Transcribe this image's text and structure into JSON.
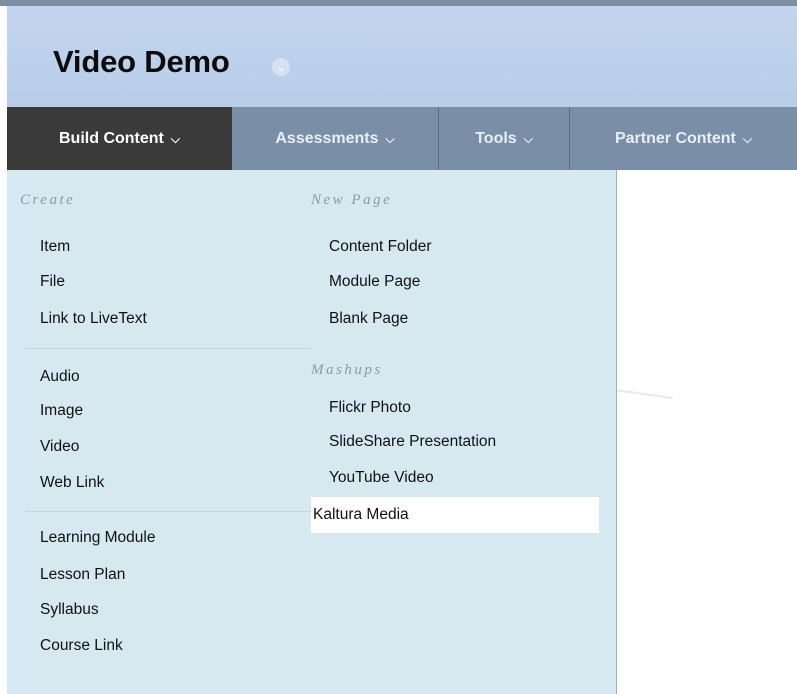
{
  "course": {
    "title": "Video Demo",
    "menu_icon": "chevron-down-icon"
  },
  "nav": {
    "tabs": [
      {
        "label": "Build Content",
        "icon": "chevron-down-icon",
        "active": true
      },
      {
        "label": "Assessments",
        "icon": "chevron-down-icon"
      },
      {
        "label": "Tools",
        "icon": "chevron-down-icon"
      },
      {
        "label": "Partner Content",
        "icon": "chevron-down-icon"
      }
    ]
  },
  "menu": {
    "create": {
      "heading": "Create",
      "group1": [
        "Item",
        "File",
        "Link to LiveText"
      ],
      "group2": [
        "Audio",
        "Image",
        "Video",
        "Web Link"
      ],
      "group3": [
        "Learning Module",
        "Lesson Plan",
        "Syllabus",
        "Course Link"
      ]
    },
    "new_page": {
      "heading": "New Page",
      "items": [
        "Content Folder",
        "Module Page",
        "Blank Page"
      ]
    },
    "mashups": {
      "heading": "Mashups",
      "items": [
        "Flickr Photo",
        "SlideShare Presentation",
        "YouTube Video",
        "Kaltura Media"
      ],
      "highlighted": "Kaltura Media"
    }
  },
  "colors": {
    "header_bg": "#c3d5ee",
    "navbar_bg": "#7b8ea7",
    "active_tab_bg": "#3a3a3a",
    "menu_bg": "#d6e9f0",
    "highlight_bg": "#ffffff"
  }
}
